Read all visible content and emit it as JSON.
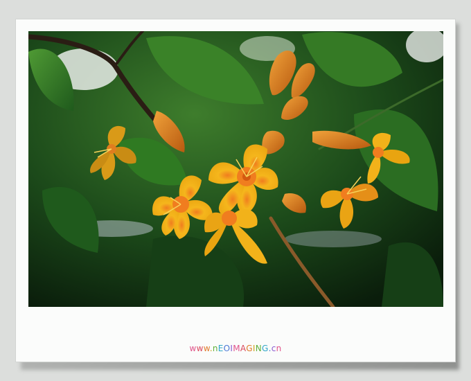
{
  "photo": {
    "subject": "yellow-flowers-on-branch",
    "colors": {
      "petal": "#f2b21a",
      "petal_dark": "#d47d12",
      "center": "#f07d1f",
      "leaf": "#2f7a22",
      "sky": "#e8ece8",
      "background": "#dcdedc",
      "frame": "#fbfcfb"
    }
  },
  "watermark": {
    "text": "www.nEOIMAGING.cn",
    "colors": [
      "#e0528a",
      "#d9485c",
      "#e07b2a",
      "#c9a318",
      "#5fb03a",
      "#2fa6c9",
      "#4a78d6",
      "#8a5ad0"
    ]
  }
}
